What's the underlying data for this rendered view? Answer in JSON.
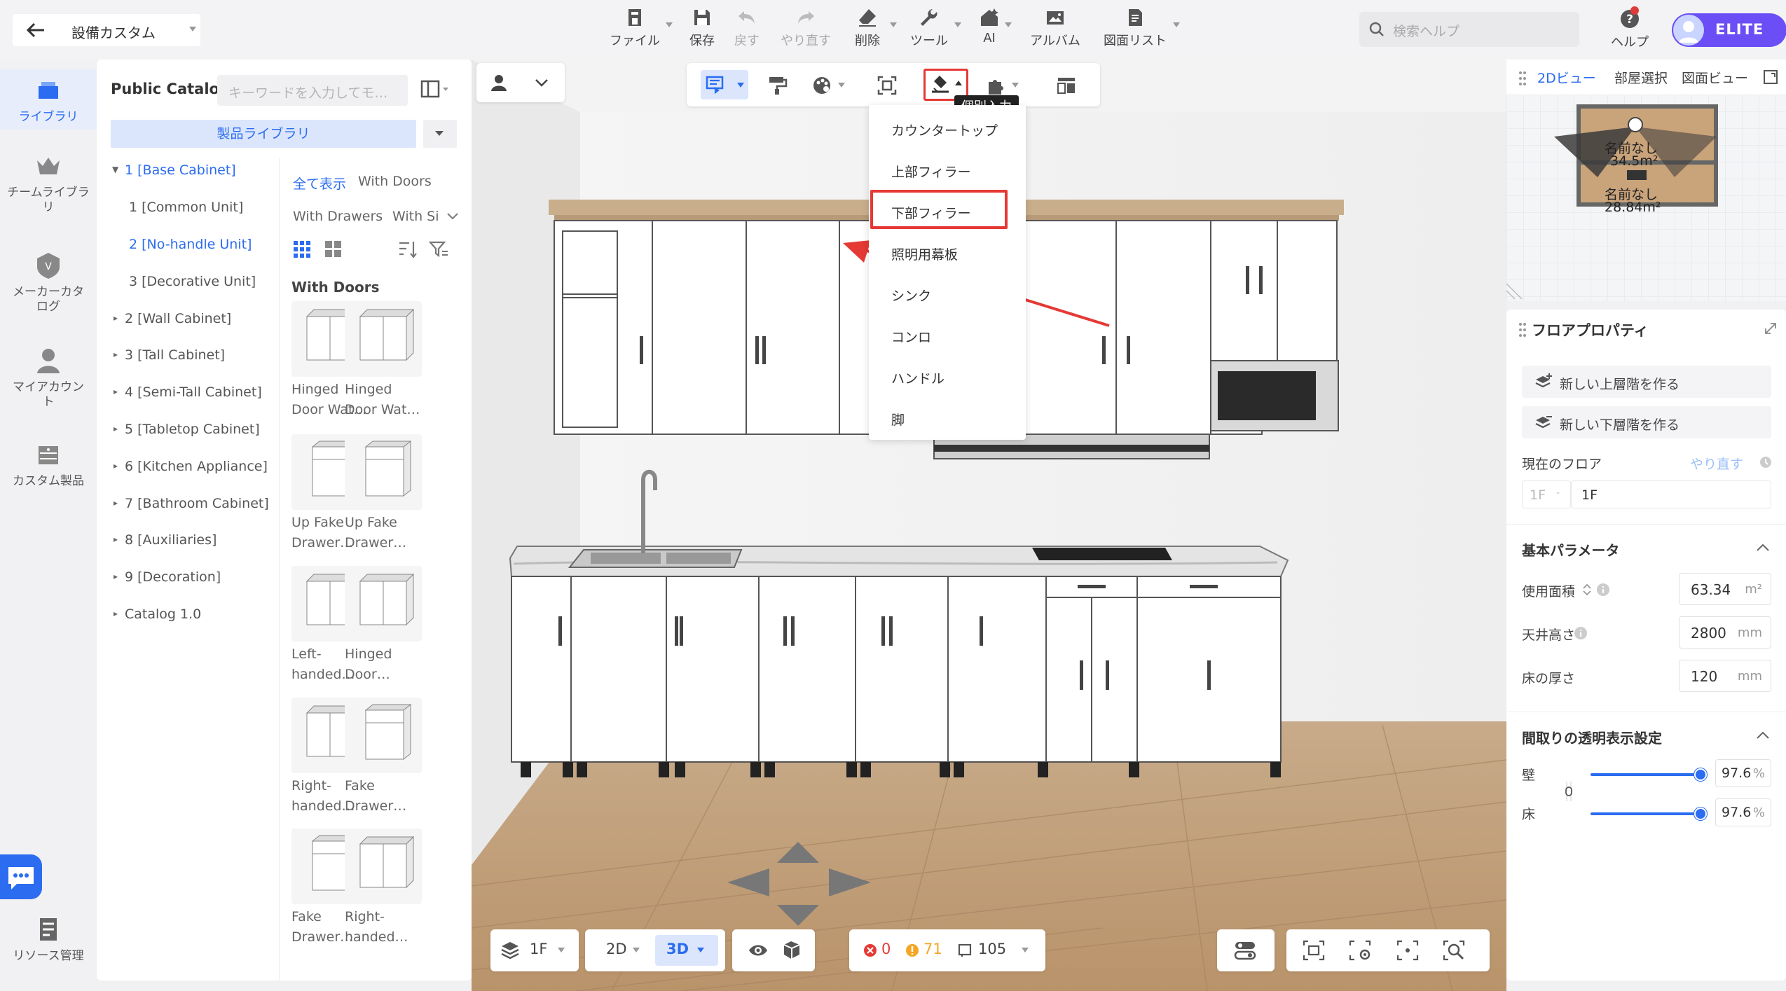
{
  "header": {
    "title": "設備カスタム",
    "tools": [
      {
        "label": "ファイル",
        "icon": "file-icon"
      },
      {
        "label": "保存",
        "icon": "save-icon"
      },
      {
        "label": "戻す",
        "icon": "undo-icon"
      },
      {
        "label": "やり直す",
        "icon": "redo-icon"
      },
      {
        "label": "削除",
        "icon": "eraser-icon"
      },
      {
        "label": "ツール",
        "icon": "wrench-icon"
      },
      {
        "label": "AI",
        "icon": "ai-house-icon"
      },
      {
        "label": "アルバム",
        "icon": "album-icon"
      },
      {
        "label": "図面リスト",
        "icon": "drawing-list-icon"
      }
    ],
    "search_placeholder": "検索ヘルプ",
    "help_label": "ヘルプ",
    "badge": "ELITE"
  },
  "left_nav": {
    "items": [
      {
        "label": "ライブラリ"
      },
      {
        "label": "チームライブラリ"
      },
      {
        "label": "メーカーカタログ"
      },
      {
        "label": "マイアカウント"
      },
      {
        "label": "カスタム製品"
      },
      {
        "label": "リソース管理"
      }
    ]
  },
  "catalog": {
    "title": "Public Catalog",
    "search_placeholder": "キーワードを入力してモ…",
    "library_select": "製品ライブラリ",
    "tree": [
      {
        "label": "1 [Base Cabinet]",
        "expanded": true
      },
      {
        "label": "1 [Common Unit]"
      },
      {
        "label": "2 [No-handle Unit]"
      },
      {
        "label": "3 [Decorative Unit]"
      },
      {
        "label": "2 [Wall Cabinet]"
      },
      {
        "label": "3 [Tall Cabinet]"
      },
      {
        "label": "4 [Semi-Tall Cabinet]"
      },
      {
        "label": "5 [Tabletop Cabinet]"
      },
      {
        "label": "6 [Kitchen Appliance]"
      },
      {
        "label": "7 [Bathroom Cabinet]"
      },
      {
        "label": "8 [Auxiliaries]"
      },
      {
        "label": "9 [Decoration]"
      },
      {
        "label": "Catalog 1.0"
      }
    ],
    "filters": {
      "show_all": "全て表示",
      "with_doors": "With Doors",
      "with_drawers": "With Drawers",
      "with_si": "With Si"
    },
    "section_heading": "With Doors",
    "products": [
      {
        "name1": "Hinged",
        "name2": "Door Wat…"
      },
      {
        "name1": "Hinged",
        "name2": "Door Wat…"
      },
      {
        "name1": "Up Fake",
        "name2": "Drawer…"
      },
      {
        "name1": "Up Fake",
        "name2": "Drawer…"
      },
      {
        "name1": "Left-",
        "name2": "handed…"
      },
      {
        "name1": "Hinged",
        "name2": "Door…"
      },
      {
        "name1": "Right-",
        "name2": "handed…"
      },
      {
        "name1": "Fake",
        "name2": "Drawer…"
      },
      {
        "name1": "Fake",
        "name2": "Drawer…"
      },
      {
        "name1": "Right-",
        "name2": "handed…"
      }
    ]
  },
  "viewport": {
    "tooltip": "個別入力",
    "dropdown": [
      "カウンタートップ",
      "上部フィラー",
      "下部フィラー",
      "照明用幕板",
      "シンク",
      "コンロ",
      "ハンドル",
      "脚"
    ],
    "dropdown_selected": "下部フィラー",
    "bottom": {
      "floor": "1F",
      "view_2d": "2D",
      "view_3d": "3D",
      "errors": "0",
      "warnings": "71",
      "items": "105"
    }
  },
  "right_panel": {
    "tabs": [
      "2Dビュー",
      "部屋選択",
      "図面ビュー"
    ],
    "minimap": {
      "room1_name": "名前なし",
      "room1_area": "34.5m²",
      "room2_name": "名前なし",
      "room2_area": "28.84m²"
    },
    "props_title": "フロアプロパティ",
    "add_upper": "新しい上層階を作る",
    "add_lower": "新しい下層階を作る",
    "current_floor_label": "現在のフロア",
    "redo_link": "やり直す",
    "floor_select": "1F",
    "floor_name": "1F",
    "basic_params": "基本パラメータ",
    "area_label": "使用面積",
    "area_value": "63.34",
    "area_unit": "m²",
    "ceiling_label": "天井高さ",
    "ceiling_value": "2800",
    "ceiling_unit": "mm",
    "floor_thick_label": "床の厚さ",
    "floor_thick_value": "120",
    "floor_thick_unit": "mm",
    "transparency_title": "間取りの透明表示設定",
    "wall_label": "壁",
    "wall_value": "97.6",
    "floor_label": "床",
    "floor_value": "97.6",
    "percent": "%"
  }
}
